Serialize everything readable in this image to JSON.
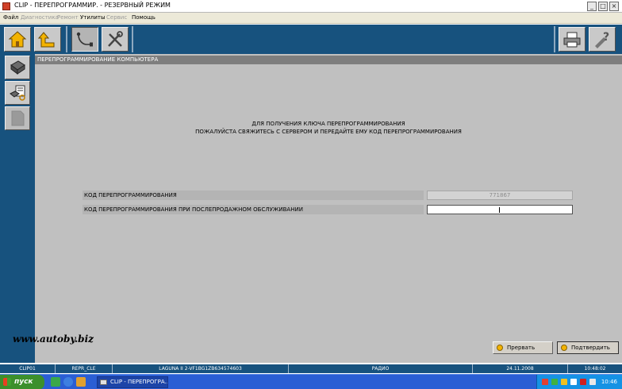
{
  "window": {
    "title": "CLIP - ПЕРЕПРОГРАММИР. - РЕЗЕРВНЫЙ РЕЖИМ",
    "controls": {
      "minimize": "_",
      "maximize": "□",
      "close": "×"
    }
  },
  "menu": {
    "items": [
      {
        "label": "Файл",
        "enabled": true
      },
      {
        "label": "Диагностика",
        "enabled": false
      },
      {
        "label": "Ремонт",
        "enabled": false
      },
      {
        "label": "Утилиты",
        "enabled": true
      },
      {
        "label": "Сервис",
        "enabled": false
      },
      {
        "label": "Помощь",
        "enabled": true
      }
    ]
  },
  "toolbar": {
    "left_icons": [
      "home-icon",
      "up-arrow-icon",
      "cable-icon",
      "tools-icon"
    ],
    "right_icons": [
      "printer-icon",
      "help-icon"
    ]
  },
  "sidebar": {
    "icons": [
      "ecu-chip-icon",
      "reprogram-icon",
      "blank-page-icon"
    ]
  },
  "section": {
    "title": "ПЕРЕПРОГРАММИРОВАНИЕ КОМПЬЮТЕРА"
  },
  "message": {
    "line1": "ДЛЯ ПОЛУЧЕНИЯ КЛЮЧА ПЕРЕПРОГРАММИРОВАНИЯ",
    "line2": "ПОЖАЛУЙСТА СВЯЖИТЕСЬ С СЕРВЕРОМ И ПЕРЕДАЙТЕ ЕМУ КОД ПЕРЕПРОГРАММИРОВАНИЯ"
  },
  "fields": {
    "reprog_code": {
      "label": "КОД ПЕРЕПРОГРАММИРОВАНИЯ",
      "value": "771867"
    },
    "aftersales_code": {
      "label": "КОД ПЕРЕПРОГРАММИРОВАНИЯ ПРИ ПОСЛЕПРОДАЖНОМ ОБСЛУЖИВАНИИ",
      "value": ""
    }
  },
  "actions": {
    "abort": "Прервать",
    "confirm": "Подтвердить"
  },
  "watermark": "www.autoby.biz",
  "status": {
    "cells": [
      "CLIP01",
      "REPR_CLE",
      "LAGUNA II 2-VF1BG1ZB634574603",
      "РАДИО",
      "24.11.2008",
      "10:48:02"
    ]
  },
  "taskbar": {
    "start_label": "пуск",
    "task_label": "CLIP - ПЕРЕПРОГРА...",
    "clock": "10:46"
  },
  "colors": {
    "app_blue": "#17527e",
    "panel_gray": "#c0c0c0",
    "header_gray": "#7e7e7e",
    "button_dot": "#f3b300",
    "taskbar_blue": "#2a5ed4",
    "start_green": "#3c8f2c"
  }
}
